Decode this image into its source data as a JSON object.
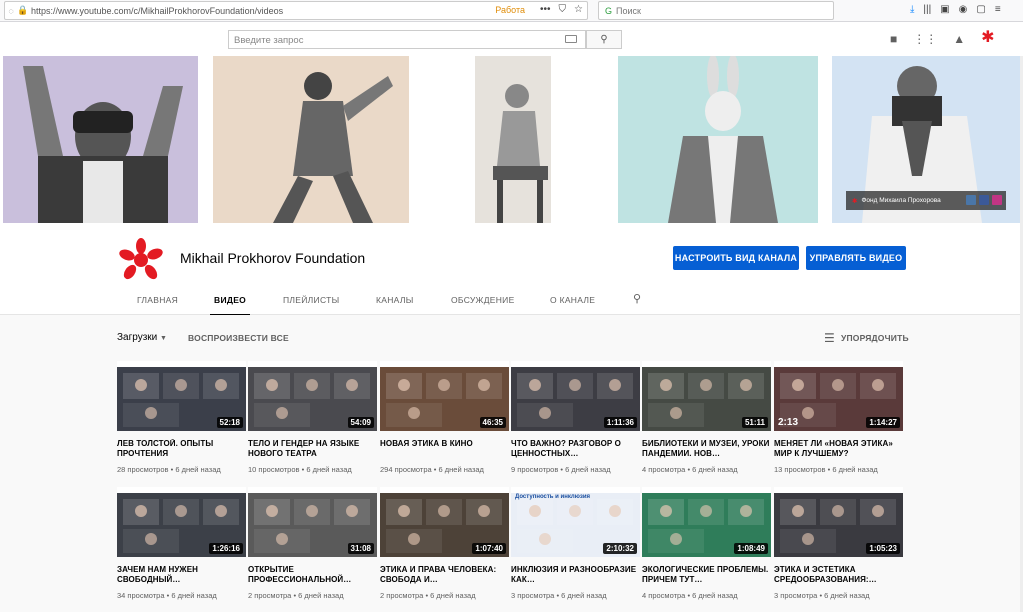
{
  "browser": {
    "url": "https://www.youtube.com/c/MikhailProkhorovFoundation/videos",
    "work_label": "Работа",
    "search_placeholder": "Поиск"
  },
  "youtube": {
    "search_placeholder": "Введите запрос",
    "brand_color": "#e31b23",
    "accent_color": "#065fd4"
  },
  "banner": {
    "badge_text": "Фонд Михаила Прохорова"
  },
  "channel": {
    "name": "Mikhail Prokhorov Foundation",
    "customize_button": "НАСТРОИТЬ ВИД КАНАЛА",
    "manage_button": "УПРАВЛЯТЬ ВИДЕО"
  },
  "tabs": [
    {
      "label": "ГЛАВНАЯ"
    },
    {
      "label": "ВИДЕО"
    },
    {
      "label": "ПЛЕЙЛИСТЫ"
    },
    {
      "label": "КАНАЛЫ"
    },
    {
      "label": "ОБСУЖДЕНИЕ"
    },
    {
      "label": "О КАНАЛЕ"
    }
  ],
  "controls": {
    "uploads_label": "Загрузки",
    "play_all": "ВОСПРОИЗВЕСТИ ВСЕ",
    "sort": "УПОРЯДОЧИТЬ"
  },
  "videos": [
    {
      "title": "ЛЕВ ТОЛСТОЙ. ОПЫТЫ ПРОЧТЕНИЯ",
      "views": "28 просмотров",
      "age": "6 дней назад",
      "duration": "52:18"
    },
    {
      "title": "ТЕЛО И ГЕНДЕР НА ЯЗЫКЕ НОВОГО ТЕАТРА",
      "views": "10 просмотров",
      "age": "6 дней назад",
      "duration": "54:09"
    },
    {
      "title": "НОВАЯ ЭТИКА В КИНО",
      "views": "294 просмотра",
      "age": "6 дней назад",
      "duration": "46:35"
    },
    {
      "title": "ЧТО ВАЖНО? РАЗГОВОР О ЦЕННОСТНЫХ…",
      "views": "9 просмотров",
      "age": "6 дней назад",
      "duration": "1:11:36"
    },
    {
      "title": "БИБЛИОТЕКИ И МУЗЕИ, УРОКИ ПАНДЕМИИ. НОВ…",
      "views": "4 просмотра",
      "age": "6 дней назад",
      "duration": "51:11"
    },
    {
      "title": "МЕНЯЕТ ЛИ «НОВАЯ ЭТИКА» МИР К ЛУЧШЕМУ?",
      "views": "13 просмотров",
      "age": "6 дней назад",
      "duration": "1:14:27",
      "overlay": "2:13"
    },
    {
      "title": "ЗАЧЕМ НАМ НУЖЕН СВОБОДНЫЙ…",
      "views": "34 просмотра",
      "age": "6 дней назад",
      "duration": "1:26:16"
    },
    {
      "title": "ОТКРЫТИЕ ПРОФЕССИОНАЛЬНОЙ…",
      "views": "2 просмотра",
      "age": "6 дней назад",
      "duration": "31:08"
    },
    {
      "title": "ЭТИКА И ПРАВА ЧЕЛОВЕКА: СВОБОДА И…",
      "views": "2 просмотра",
      "age": "6 дней назад",
      "duration": "1:07:40"
    },
    {
      "title": "ИНКЛЮЗИЯ И РАЗНООБРАЗИЕ КАК…",
      "views": "3 просмотра",
      "age": "6 дней назад",
      "duration": "2:10:32",
      "thumb_label": "Доступность и инклюзия"
    },
    {
      "title": "ЭКОЛОГИЧЕСКИЕ ПРОБЛЕМЫ. ПРИЧЕМ ТУТ…",
      "views": "4 просмотра",
      "age": "6 дней назад",
      "duration": "1:08:49"
    },
    {
      "title": "ЭТИКА И ЭСТЕТИКА СРЕДООБРАЗОВАНИЯ:…",
      "views": "3 просмотра",
      "age": "6 дней назад",
      "duration": "1:05:23"
    }
  ]
}
